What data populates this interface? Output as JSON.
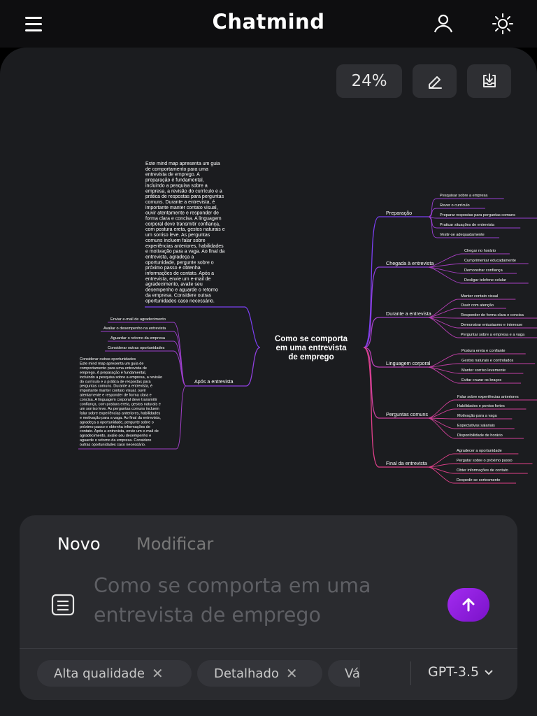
{
  "app": {
    "title": "Chatmind"
  },
  "toolbar": {
    "zoom": "24%"
  },
  "mindmap": {
    "root": "Como se comporta em uma entrevista de emprego",
    "root_lines": [
      "Como se comporta",
      "em uma entrevista",
      "de emprego"
    ],
    "summary_lines": [
      "Este mind map apresenta um guia",
      "de comportamento para uma",
      "entrevista de emprego. A",
      "preparação é fundamental,",
      "incluindo a pesquisa sobre a",
      "empresa, a revisão do currículo e a",
      "prática de respostas para perguntas",
      "comuns. Durante a entrevista, é",
      "importante manter contato visual,",
      "ouvir atentamente e responder de",
      "forma clara e concisa. A linguagem",
      "corporal deve transmitir confiança,",
      "com postura ereta, gestos naturais e",
      "um sorriso leve. As perguntas",
      "comuns incluem falar sobre",
      "experiências anteriores, habilidades",
      "e motivação para a vaga. Ao final da",
      "entrevista, agradeça a",
      "oportunidade, pergunte sobre o",
      "próximo passo e obtenha",
      "informações de contato. Após a",
      "entrevista, envie um e-mail de",
      "agradecimento, avalie seu",
      "desempenho e aguarde o retorno",
      "da empresa. Considere outras",
      "oportunidades caso necessário."
    ],
    "left_branch": {
      "label": "Após a entrevista",
      "children": [
        "Enviar e-mail de agradecimento",
        "Avaliar o desempenho na entrevista",
        "Aguardar o retorno da empresa",
        "Considerar outras oportunidades"
      ],
      "note_lines": [
        "Considerar outras oportunidades",
        "Este mind map apresenta um guia de",
        "comportamento para uma entrevista de",
        "emprego. A preparação é fundamental,",
        "incluindo a pesquisa sobre a empresa, a revisão",
        "do currículo e a prática de respostas para",
        "perguntas comuns. Durante a entrevista, é",
        "importante manter contato visual, ouvir",
        "atentamente e responder de forma clara e",
        "concisa. A linguagem corporal deve transmitir",
        "confiança, com postura ereta, gestos naturais e",
        "um sorriso leve. As perguntas comuns incluem",
        "falar sobre experiências anteriores, habilidades",
        "e motivação para a vaga. Ao final da entrevista,",
        "agradeça a oportunidade, pergunte sobre o",
        "próximo passo e obtenha informações de",
        "contato. Após a entrevista, envie um e-mail de",
        "agradecimento, avalie seu desempenho e",
        "aguarde o retorno da empresa. Considere",
        "outras oportunidades caso necessário."
      ]
    },
    "right_branches": [
      {
        "label": "Preparação",
        "children": [
          "Pesquisar sobre a empresa",
          "Rever o currículo",
          "Preparar respostas para perguntas comuns",
          "Praticar situações de entrevista",
          "Vestir-se adequadamente"
        ]
      },
      {
        "label": "Chegada à entrevista",
        "children": [
          "Chegar no horário",
          "Cumprimentar educadamente",
          "Demonstrar confiança",
          "Desligar telefone celular"
        ]
      },
      {
        "label": "Durante a entrevista",
        "children": [
          "Manter contato visual",
          "Ouvir com atenção",
          "Responder de forma clara e concisa",
          "Demonstrar entusiasmo e interesse",
          "Perguntar sobre a empresa e a vaga"
        ]
      },
      {
        "label": "Linguagem corporal",
        "children": [
          "Postura ereta e confiante",
          "Gestos naturais e controlados",
          "Manter sorriso levemente",
          "Evitar cruzar os braços"
        ]
      },
      {
        "label": "Perguntas comuns",
        "children": [
          "Falar sobre experiências anteriores",
          "Habilidades e pontos fortes",
          "Motivação para a vaga",
          "Expectativas salariais",
          "Disponibilidade de horário"
        ]
      },
      {
        "label": "Final da entrevista",
        "children": [
          "Agradecer a oportunidade",
          "Pergutar sobre o próximo passo",
          "Obter informações de contato",
          "Despedir-se cortesmente"
        ]
      }
    ]
  },
  "composer": {
    "tabs": [
      "Novo",
      "Modificar"
    ],
    "prompt_lines": [
      "Como se comporta em uma",
      "entrevista de emprego"
    ],
    "chips": [
      "Alta qualidade",
      "Detalhado",
      "Vá"
    ],
    "model": "GPT-3.5"
  },
  "colors": {
    "background": "#1b1c1f",
    "accent": "#9b2fe6",
    "branch_purple": "#7b3ff2",
    "branch_pink": "#e0408a"
  },
  "icons": [
    "menu-icon",
    "user-icon",
    "sun-icon",
    "edit-icon",
    "download-icon",
    "document-icon",
    "arrow-up-icon",
    "close-icon",
    "chevron-down-icon"
  ]
}
